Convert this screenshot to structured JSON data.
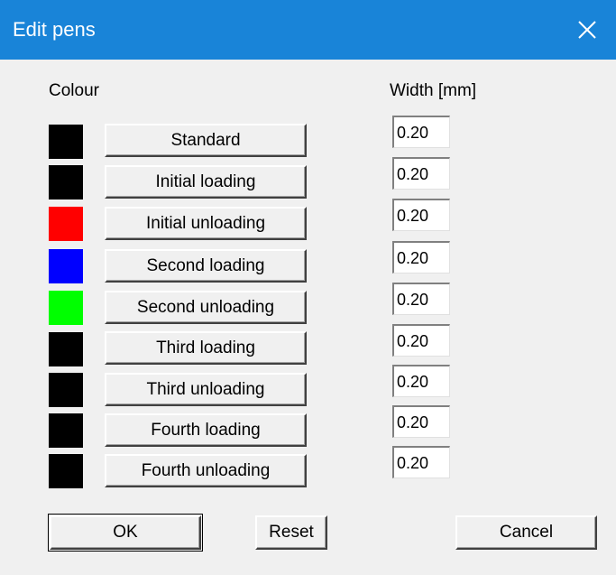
{
  "window": {
    "title": "Edit pens"
  },
  "headers": {
    "colour": "Colour",
    "width": "Width [mm]"
  },
  "pens": [
    {
      "label": "Standard",
      "color": "#000000",
      "width": "0.20"
    },
    {
      "label": "Initial loading",
      "color": "#000000",
      "width": "0.20"
    },
    {
      "label": "Initial unloading",
      "color": "#ff0000",
      "width": "0.20"
    },
    {
      "label": "Second loading",
      "color": "#0000ff",
      "width": "0.20"
    },
    {
      "label": "Second unloading",
      "color": "#00ff00",
      "width": "0.20"
    },
    {
      "label": "Third loading",
      "color": "#000000",
      "width": "0.20"
    },
    {
      "label": "Third unloading",
      "color": "#000000",
      "width": "0.20"
    },
    {
      "label": "Fourth loading",
      "color": "#000000",
      "width": "0.20"
    },
    {
      "label": "Fourth unloading",
      "color": "#000000",
      "width": "0.20"
    }
  ],
  "buttons": {
    "ok": "OK",
    "reset": "Reset",
    "cancel": "Cancel"
  },
  "colors": {
    "titlebar": "#1984d8",
    "background": "#f0f0f0"
  }
}
